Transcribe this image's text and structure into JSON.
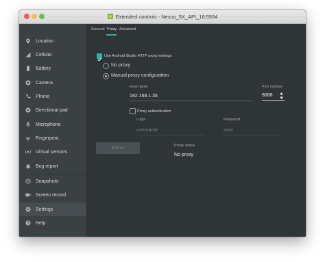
{
  "window": {
    "title": "Extended controls - Nexus_5X_API_18:5554"
  },
  "sidebar": {
    "items": [
      {
        "label": "Location",
        "icon": "location-pin-icon"
      },
      {
        "label": "Cellular",
        "icon": "cellular-signal-icon"
      },
      {
        "label": "Battery",
        "icon": "battery-icon"
      },
      {
        "label": "Camera",
        "icon": "camera-icon"
      },
      {
        "label": "Phone",
        "icon": "phone-icon"
      },
      {
        "label": "Directional pad",
        "icon": "dpad-icon"
      },
      {
        "label": "Microphone",
        "icon": "microphone-icon"
      },
      {
        "label": "Fingerprint",
        "icon": "fingerprint-icon"
      },
      {
        "label": "Virtual sensors",
        "icon": "virtual-sensors-icon"
      },
      {
        "label": "Bug report",
        "icon": "bug-icon"
      },
      {
        "label": "Snapshots",
        "icon": "snapshots-icon"
      },
      {
        "label": "Screen record",
        "icon": "screen-record-icon"
      },
      {
        "label": "Settings",
        "icon": "gear-icon",
        "selected": true
      },
      {
        "label": "Help",
        "icon": "help-icon"
      }
    ]
  },
  "tabs": [
    {
      "label": "General"
    },
    {
      "label": "Proxy",
      "active": true
    },
    {
      "label": "Advanced"
    }
  ],
  "proxy": {
    "use_studio_label": "Use Android Studio HTTP proxy settings",
    "use_studio_checked": true,
    "no_proxy_label": "No proxy",
    "manual_label": "Manual proxy configuration",
    "host_label": "Host name",
    "host_value": "192.168.1.35",
    "port_label": "Port number",
    "port_value": "8888",
    "auth_label": "Proxy authentication",
    "auth_checked": false,
    "login_label": "Login",
    "login_value": "username",
    "password_label": "Password",
    "password_value": "xxxx",
    "apply_label": "APPLY",
    "status_label": "Proxy status",
    "status_value": "No proxy"
  },
  "colors": {
    "accent": "#2bb5a6",
    "background": "#2f3437",
    "sidebar": "#3b4043"
  }
}
